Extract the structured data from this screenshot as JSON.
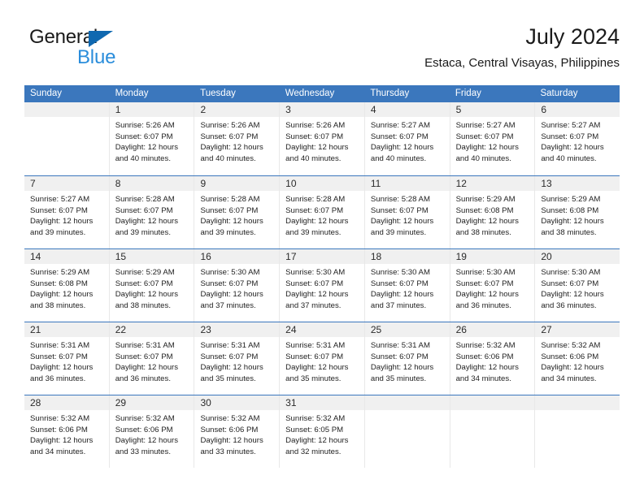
{
  "logo": {
    "word_one": "General",
    "word_two": "Blue",
    "triangle_icon": "triangle-icon",
    "accent_dark": "#0f68b0",
    "accent_light": "#2a8ddb"
  },
  "header": {
    "title": "July 2024",
    "subtitle": "Estaca, Central Visayas, Philippines"
  },
  "calendar": {
    "header_color": "#3b77bd",
    "weekdays": [
      "Sunday",
      "Monday",
      "Tuesday",
      "Wednesday",
      "Thursday",
      "Friday",
      "Saturday"
    ],
    "weeks": [
      [
        {
          "day": "",
          "lines": []
        },
        {
          "day": "1",
          "lines": [
            "Sunrise: 5:26 AM",
            "Sunset: 6:07 PM",
            "Daylight: 12 hours",
            "and 40 minutes."
          ]
        },
        {
          "day": "2",
          "lines": [
            "Sunrise: 5:26 AM",
            "Sunset: 6:07 PM",
            "Daylight: 12 hours",
            "and 40 minutes."
          ]
        },
        {
          "day": "3",
          "lines": [
            "Sunrise: 5:26 AM",
            "Sunset: 6:07 PM",
            "Daylight: 12 hours",
            "and 40 minutes."
          ]
        },
        {
          "day": "4",
          "lines": [
            "Sunrise: 5:27 AM",
            "Sunset: 6:07 PM",
            "Daylight: 12 hours",
            "and 40 minutes."
          ]
        },
        {
          "day": "5",
          "lines": [
            "Sunrise: 5:27 AM",
            "Sunset: 6:07 PM",
            "Daylight: 12 hours",
            "and 40 minutes."
          ]
        },
        {
          "day": "6",
          "lines": [
            "Sunrise: 5:27 AM",
            "Sunset: 6:07 PM",
            "Daylight: 12 hours",
            "and 40 minutes."
          ]
        }
      ],
      [
        {
          "day": "7",
          "lines": [
            "Sunrise: 5:27 AM",
            "Sunset: 6:07 PM",
            "Daylight: 12 hours",
            "and 39 minutes."
          ]
        },
        {
          "day": "8",
          "lines": [
            "Sunrise: 5:28 AM",
            "Sunset: 6:07 PM",
            "Daylight: 12 hours",
            "and 39 minutes."
          ]
        },
        {
          "day": "9",
          "lines": [
            "Sunrise: 5:28 AM",
            "Sunset: 6:07 PM",
            "Daylight: 12 hours",
            "and 39 minutes."
          ]
        },
        {
          "day": "10",
          "lines": [
            "Sunrise: 5:28 AM",
            "Sunset: 6:07 PM",
            "Daylight: 12 hours",
            "and 39 minutes."
          ]
        },
        {
          "day": "11",
          "lines": [
            "Sunrise: 5:28 AM",
            "Sunset: 6:07 PM",
            "Daylight: 12 hours",
            "and 39 minutes."
          ]
        },
        {
          "day": "12",
          "lines": [
            "Sunrise: 5:29 AM",
            "Sunset: 6:08 PM",
            "Daylight: 12 hours",
            "and 38 minutes."
          ]
        },
        {
          "day": "13",
          "lines": [
            "Sunrise: 5:29 AM",
            "Sunset: 6:08 PM",
            "Daylight: 12 hours",
            "and 38 minutes."
          ]
        }
      ],
      [
        {
          "day": "14",
          "lines": [
            "Sunrise: 5:29 AM",
            "Sunset: 6:08 PM",
            "Daylight: 12 hours",
            "and 38 minutes."
          ]
        },
        {
          "day": "15",
          "lines": [
            "Sunrise: 5:29 AM",
            "Sunset: 6:07 PM",
            "Daylight: 12 hours",
            "and 38 minutes."
          ]
        },
        {
          "day": "16",
          "lines": [
            "Sunrise: 5:30 AM",
            "Sunset: 6:07 PM",
            "Daylight: 12 hours",
            "and 37 minutes."
          ]
        },
        {
          "day": "17",
          "lines": [
            "Sunrise: 5:30 AM",
            "Sunset: 6:07 PM",
            "Daylight: 12 hours",
            "and 37 minutes."
          ]
        },
        {
          "day": "18",
          "lines": [
            "Sunrise: 5:30 AM",
            "Sunset: 6:07 PM",
            "Daylight: 12 hours",
            "and 37 minutes."
          ]
        },
        {
          "day": "19",
          "lines": [
            "Sunrise: 5:30 AM",
            "Sunset: 6:07 PM",
            "Daylight: 12 hours",
            "and 36 minutes."
          ]
        },
        {
          "day": "20",
          "lines": [
            "Sunrise: 5:30 AM",
            "Sunset: 6:07 PM",
            "Daylight: 12 hours",
            "and 36 minutes."
          ]
        }
      ],
      [
        {
          "day": "21",
          "lines": [
            "Sunrise: 5:31 AM",
            "Sunset: 6:07 PM",
            "Daylight: 12 hours",
            "and 36 minutes."
          ]
        },
        {
          "day": "22",
          "lines": [
            "Sunrise: 5:31 AM",
            "Sunset: 6:07 PM",
            "Daylight: 12 hours",
            "and 36 minutes."
          ]
        },
        {
          "day": "23",
          "lines": [
            "Sunrise: 5:31 AM",
            "Sunset: 6:07 PM",
            "Daylight: 12 hours",
            "and 35 minutes."
          ]
        },
        {
          "day": "24",
          "lines": [
            "Sunrise: 5:31 AM",
            "Sunset: 6:07 PM",
            "Daylight: 12 hours",
            "and 35 minutes."
          ]
        },
        {
          "day": "25",
          "lines": [
            "Sunrise: 5:31 AM",
            "Sunset: 6:07 PM",
            "Daylight: 12 hours",
            "and 35 minutes."
          ]
        },
        {
          "day": "26",
          "lines": [
            "Sunrise: 5:32 AM",
            "Sunset: 6:06 PM",
            "Daylight: 12 hours",
            "and 34 minutes."
          ]
        },
        {
          "day": "27",
          "lines": [
            "Sunrise: 5:32 AM",
            "Sunset: 6:06 PM",
            "Daylight: 12 hours",
            "and 34 minutes."
          ]
        }
      ],
      [
        {
          "day": "28",
          "lines": [
            "Sunrise: 5:32 AM",
            "Sunset: 6:06 PM",
            "Daylight: 12 hours",
            "and 34 minutes."
          ]
        },
        {
          "day": "29",
          "lines": [
            "Sunrise: 5:32 AM",
            "Sunset: 6:06 PM",
            "Daylight: 12 hours",
            "and 33 minutes."
          ]
        },
        {
          "day": "30",
          "lines": [
            "Sunrise: 5:32 AM",
            "Sunset: 6:06 PM",
            "Daylight: 12 hours",
            "and 33 minutes."
          ]
        },
        {
          "day": "31",
          "lines": [
            "Sunrise: 5:32 AM",
            "Sunset: 6:05 PM",
            "Daylight: 12 hours",
            "and 32 minutes."
          ]
        },
        {
          "day": "",
          "lines": []
        },
        {
          "day": "",
          "lines": []
        },
        {
          "day": "",
          "lines": []
        }
      ]
    ]
  }
}
